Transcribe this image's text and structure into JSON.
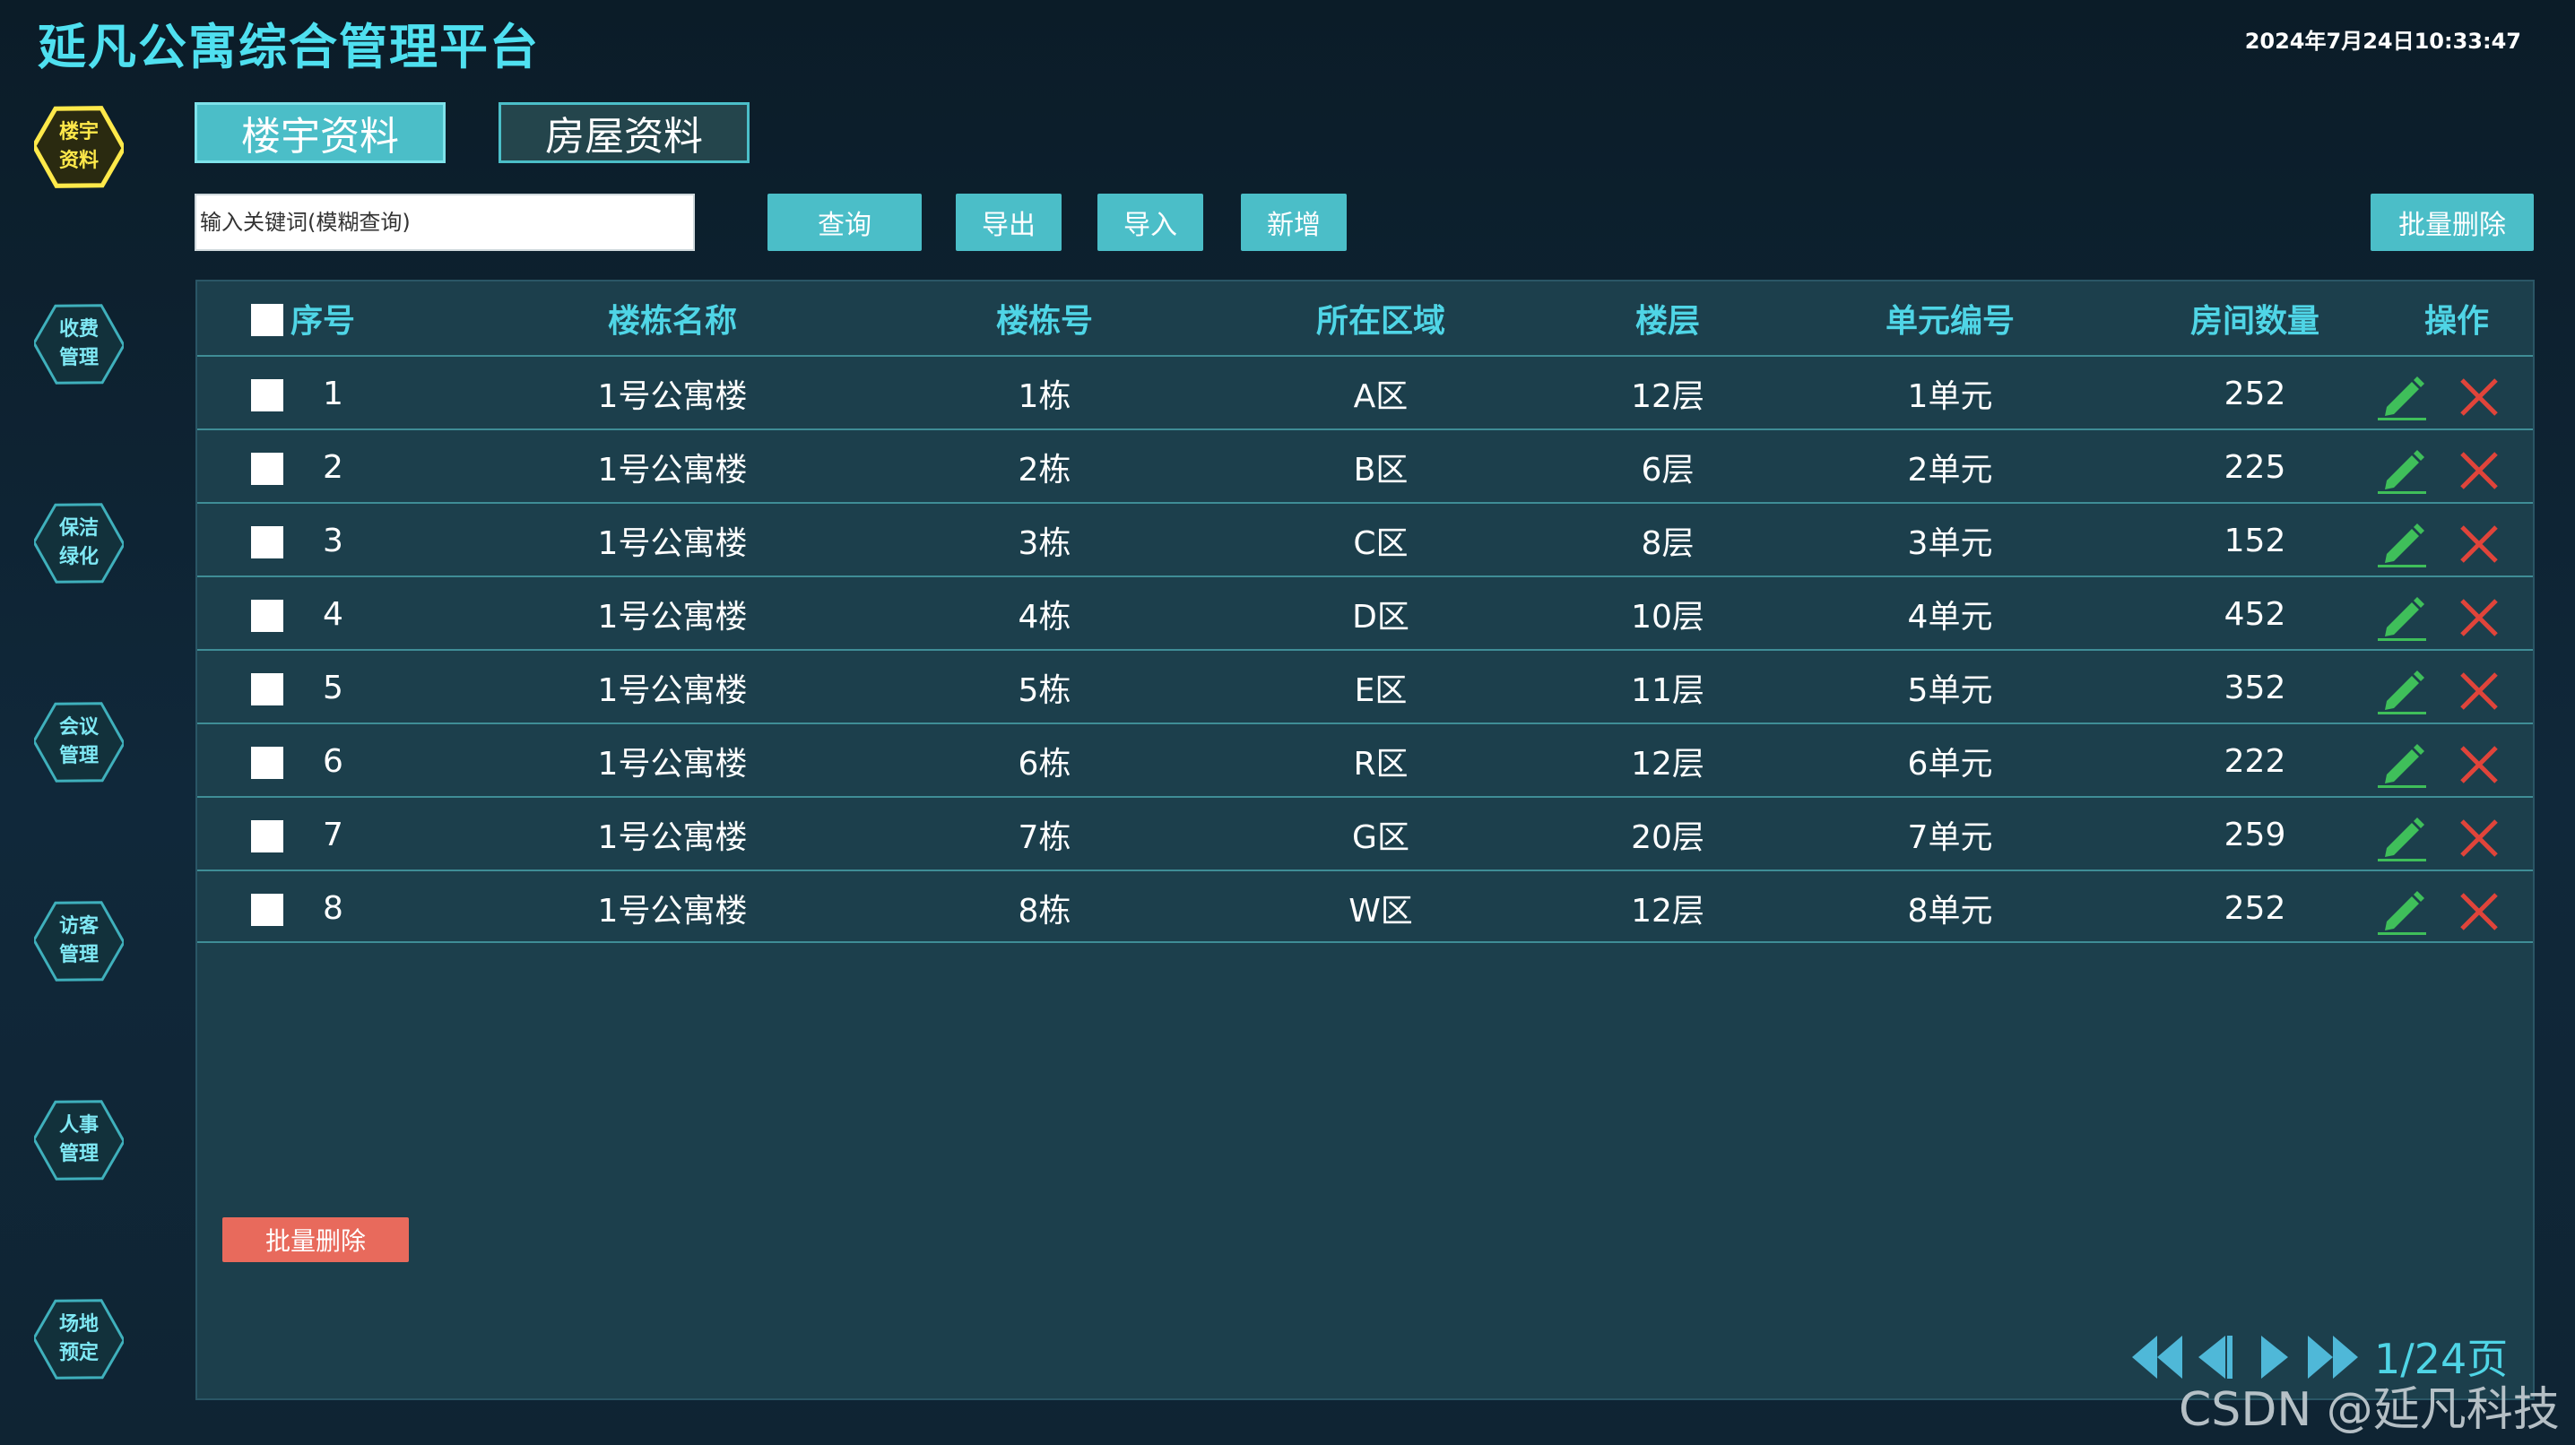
{
  "app": {
    "title": "延凡公寓综合管理平台",
    "datetime": "2024年7月24日10:33:47",
    "watermark": "CSDN @延凡科技"
  },
  "sidebar": {
    "items": [
      {
        "label_line1": "楼宇",
        "label_line2": "资料",
        "active": true
      },
      {
        "label_line1": "收费",
        "label_line2": "管理",
        "active": false
      },
      {
        "label_line1": "保洁",
        "label_line2": "绿化",
        "active": false
      },
      {
        "label_line1": "会议",
        "label_line2": "管理",
        "active": false
      },
      {
        "label_line1": "访客",
        "label_line2": "管理",
        "active": false
      },
      {
        "label_line1": "人事",
        "label_line2": "管理",
        "active": false
      },
      {
        "label_line1": "场地",
        "label_line2": "预定",
        "active": false
      }
    ]
  },
  "tabs": [
    {
      "label": "楼宇资料",
      "active": true
    },
    {
      "label": "房屋资料",
      "active": false
    }
  ],
  "toolbar": {
    "search_placeholder": "输入关键词(模糊查询)",
    "query_label": "查询",
    "export_label": "导出",
    "import_label": "导入",
    "add_label": "新增",
    "batch_delete_label": "批量删除"
  },
  "table": {
    "headers": {
      "index": "序号",
      "building_name": "楼栋名称",
      "building_no": "楼栋号",
      "area": "所在区域",
      "floors": "楼层",
      "unit_no": "单元编号",
      "room_count": "房间数量",
      "actions": "操作"
    },
    "rows": [
      {
        "index": "1",
        "building_name": "1号公寓楼",
        "building_no": "1栋",
        "area": "A区",
        "floors": "12层",
        "unit_no": "1单元",
        "room_count": "252"
      },
      {
        "index": "2",
        "building_name": "1号公寓楼",
        "building_no": "2栋",
        "area": "B区",
        "floors": "6层",
        "unit_no": "2单元",
        "room_count": "225"
      },
      {
        "index": "3",
        "building_name": "1号公寓楼",
        "building_no": "3栋",
        "area": "C区",
        "floors": "8层",
        "unit_no": "3单元",
        "room_count": "152"
      },
      {
        "index": "4",
        "building_name": "1号公寓楼",
        "building_no": "4栋",
        "area": "D区",
        "floors": "10层",
        "unit_no": "4单元",
        "room_count": "452"
      },
      {
        "index": "5",
        "building_name": "1号公寓楼",
        "building_no": "5栋",
        "area": "E区",
        "floors": "11层",
        "unit_no": "5单元",
        "room_count": "352"
      },
      {
        "index": "6",
        "building_name": "1号公寓楼",
        "building_no": "6栋",
        "area": "R区",
        "floors": "12层",
        "unit_no": "6单元",
        "room_count": "222"
      },
      {
        "index": "7",
        "building_name": "1号公寓楼",
        "building_no": "7栋",
        "area": "G区",
        "floors": "20层",
        "unit_no": "7单元",
        "room_count": "259"
      },
      {
        "index": "8",
        "building_name": "1号公寓楼",
        "building_no": "8栋",
        "area": "W区",
        "floors": "12层",
        "unit_no": "8单元",
        "room_count": "252"
      }
    ],
    "batch_delete_label": "批量删除"
  },
  "pagination": {
    "page_text": "1/24页"
  },
  "colors": {
    "accent": "#4bbec8",
    "title": "#4fe0f0",
    "active_hex": "#ffe94a",
    "edit_icon": "#3fbf5a",
    "delete_icon": "#e0443a",
    "batch_delete_bottom": "#e86a5c"
  }
}
